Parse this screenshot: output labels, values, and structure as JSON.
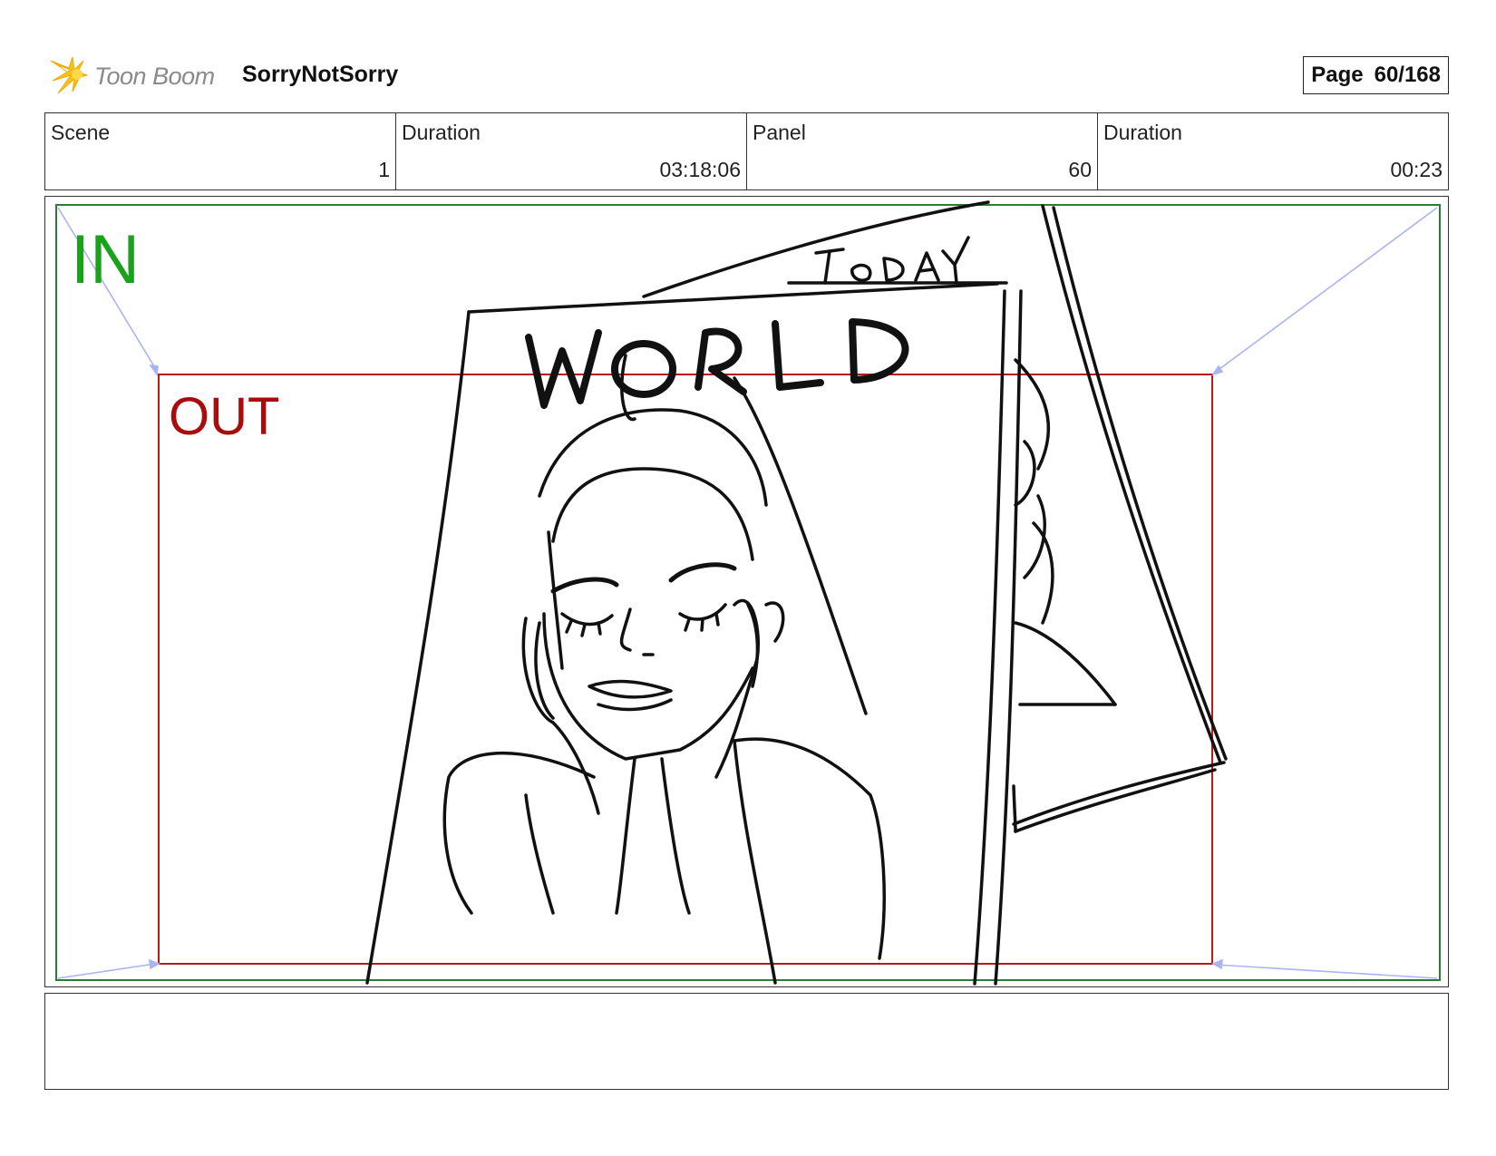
{
  "header": {
    "logo_text": "Toon Boom",
    "logo_icon": "toon-boom-star-icon",
    "project_title": "SorryNotSorry",
    "page_label": "Page",
    "page_number": "60/168"
  },
  "info": [
    {
      "label": "Scene",
      "value": "1"
    },
    {
      "label": "Duration",
      "value": "03:18:06"
    },
    {
      "label": "Panel",
      "value": "60"
    },
    {
      "label": "Duration",
      "value": "00:23"
    }
  ],
  "panel": {
    "in_label": "IN",
    "out_label": "OUT",
    "drawing_text_title": "WORLD",
    "drawing_text_banner": "TODAY",
    "in_frame_color": "#2e7d32",
    "out_frame_color": "#b71c1c",
    "camera_arrow_color": "#aab4f0"
  },
  "notes": {
    "text": ""
  }
}
